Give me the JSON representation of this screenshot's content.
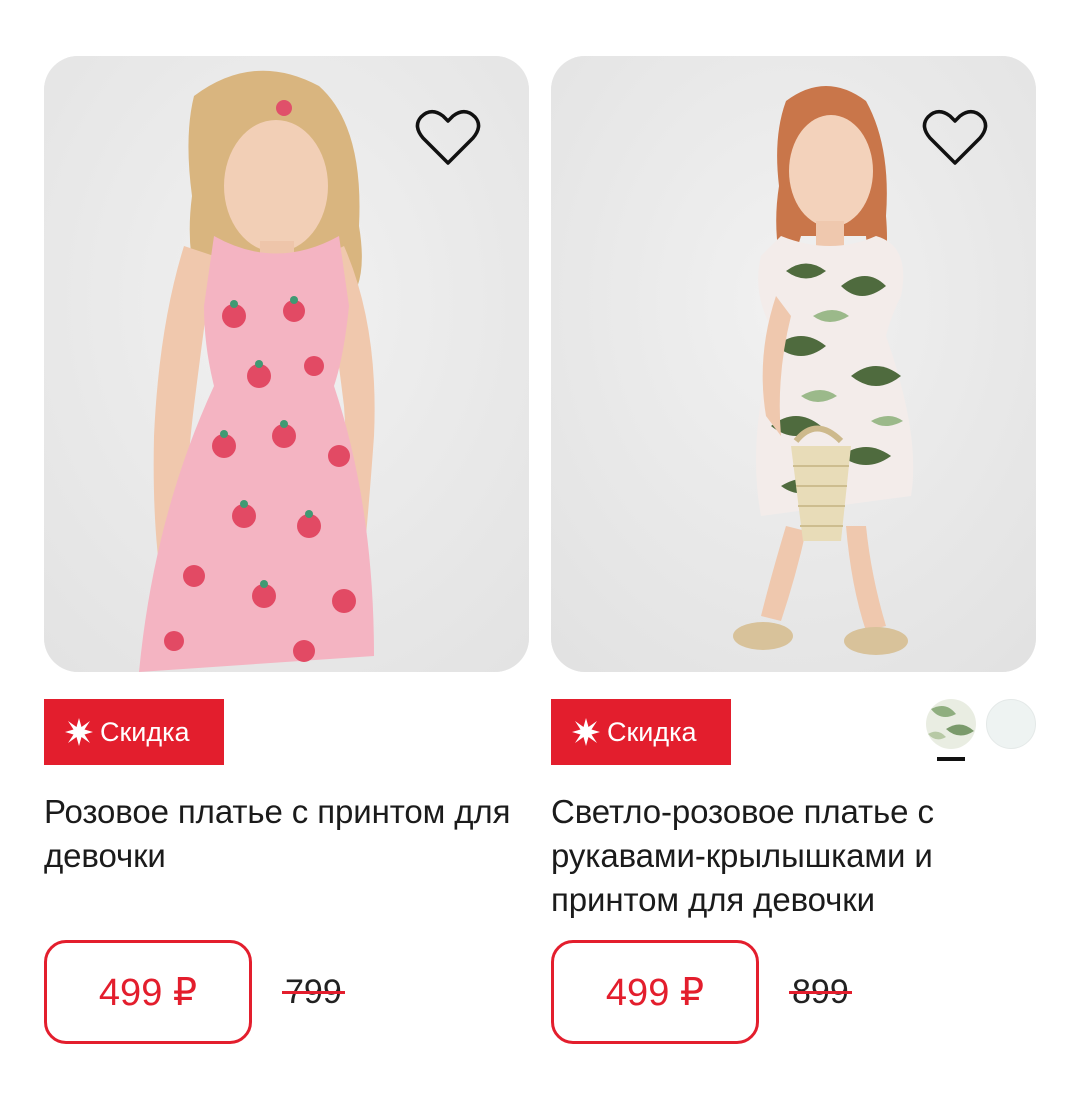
{
  "products": [
    {
      "badge": "Скидка",
      "title": "Розовое платье с принтом для девочки",
      "price": "499 ₽",
      "old_price": "799",
      "favorite_icon": "heart-outline-icon",
      "badge_icon": "sparkle-icon"
    },
    {
      "badge": "Скидка",
      "title": "Светло-розовое платье с рукавами-крылышками и принтом для девочки",
      "price": "499 ₽",
      "old_price": "899",
      "favorite_icon": "heart-outline-icon",
      "badge_icon": "sparkle-icon",
      "color_swatches": [
        "leaf-print",
        "light"
      ]
    }
  ],
  "colors": {
    "accent": "#e31e2d",
    "text": "#1b1b1b",
    "photo_bg": "#ececec"
  }
}
